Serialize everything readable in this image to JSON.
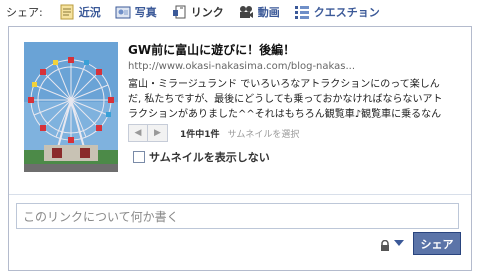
{
  "share_bar": {
    "label": "シェア:",
    "tabs": [
      {
        "label": "近況",
        "icon": "status-icon"
      },
      {
        "label": "写真",
        "icon": "photo-icon"
      },
      {
        "label": "リンク",
        "icon": "link-icon",
        "active": true
      },
      {
        "label": "動画",
        "icon": "video-icon"
      },
      {
        "label": "クエスチョン",
        "icon": "question-icon"
      }
    ]
  },
  "attachment": {
    "title": "GW前に富山に遊びに！後編！",
    "url": "http://www.okasi-nakasima.com/blog-nakas...",
    "description": "富山・ミラージュランド でいろいろなアトラクションにのって楽しんだ, 私たちですが、最後にどうしても乗っておかなければならないアトラクションがありました^^それはもちろん観覧車♪観覧車に乗るなんてかなりス…",
    "count": "1件中1件",
    "choose_thumbnail": "サムネイルを選択",
    "no_thumbnail_label": "サムネイルを表示しない"
  },
  "comment": {
    "placeholder": "このリンクについて何か書く"
  },
  "actions": {
    "share_label": "シェア"
  },
  "colors": {
    "brand": "#3b5998",
    "button": "#5b74a8",
    "border": "#b4bbcd"
  }
}
